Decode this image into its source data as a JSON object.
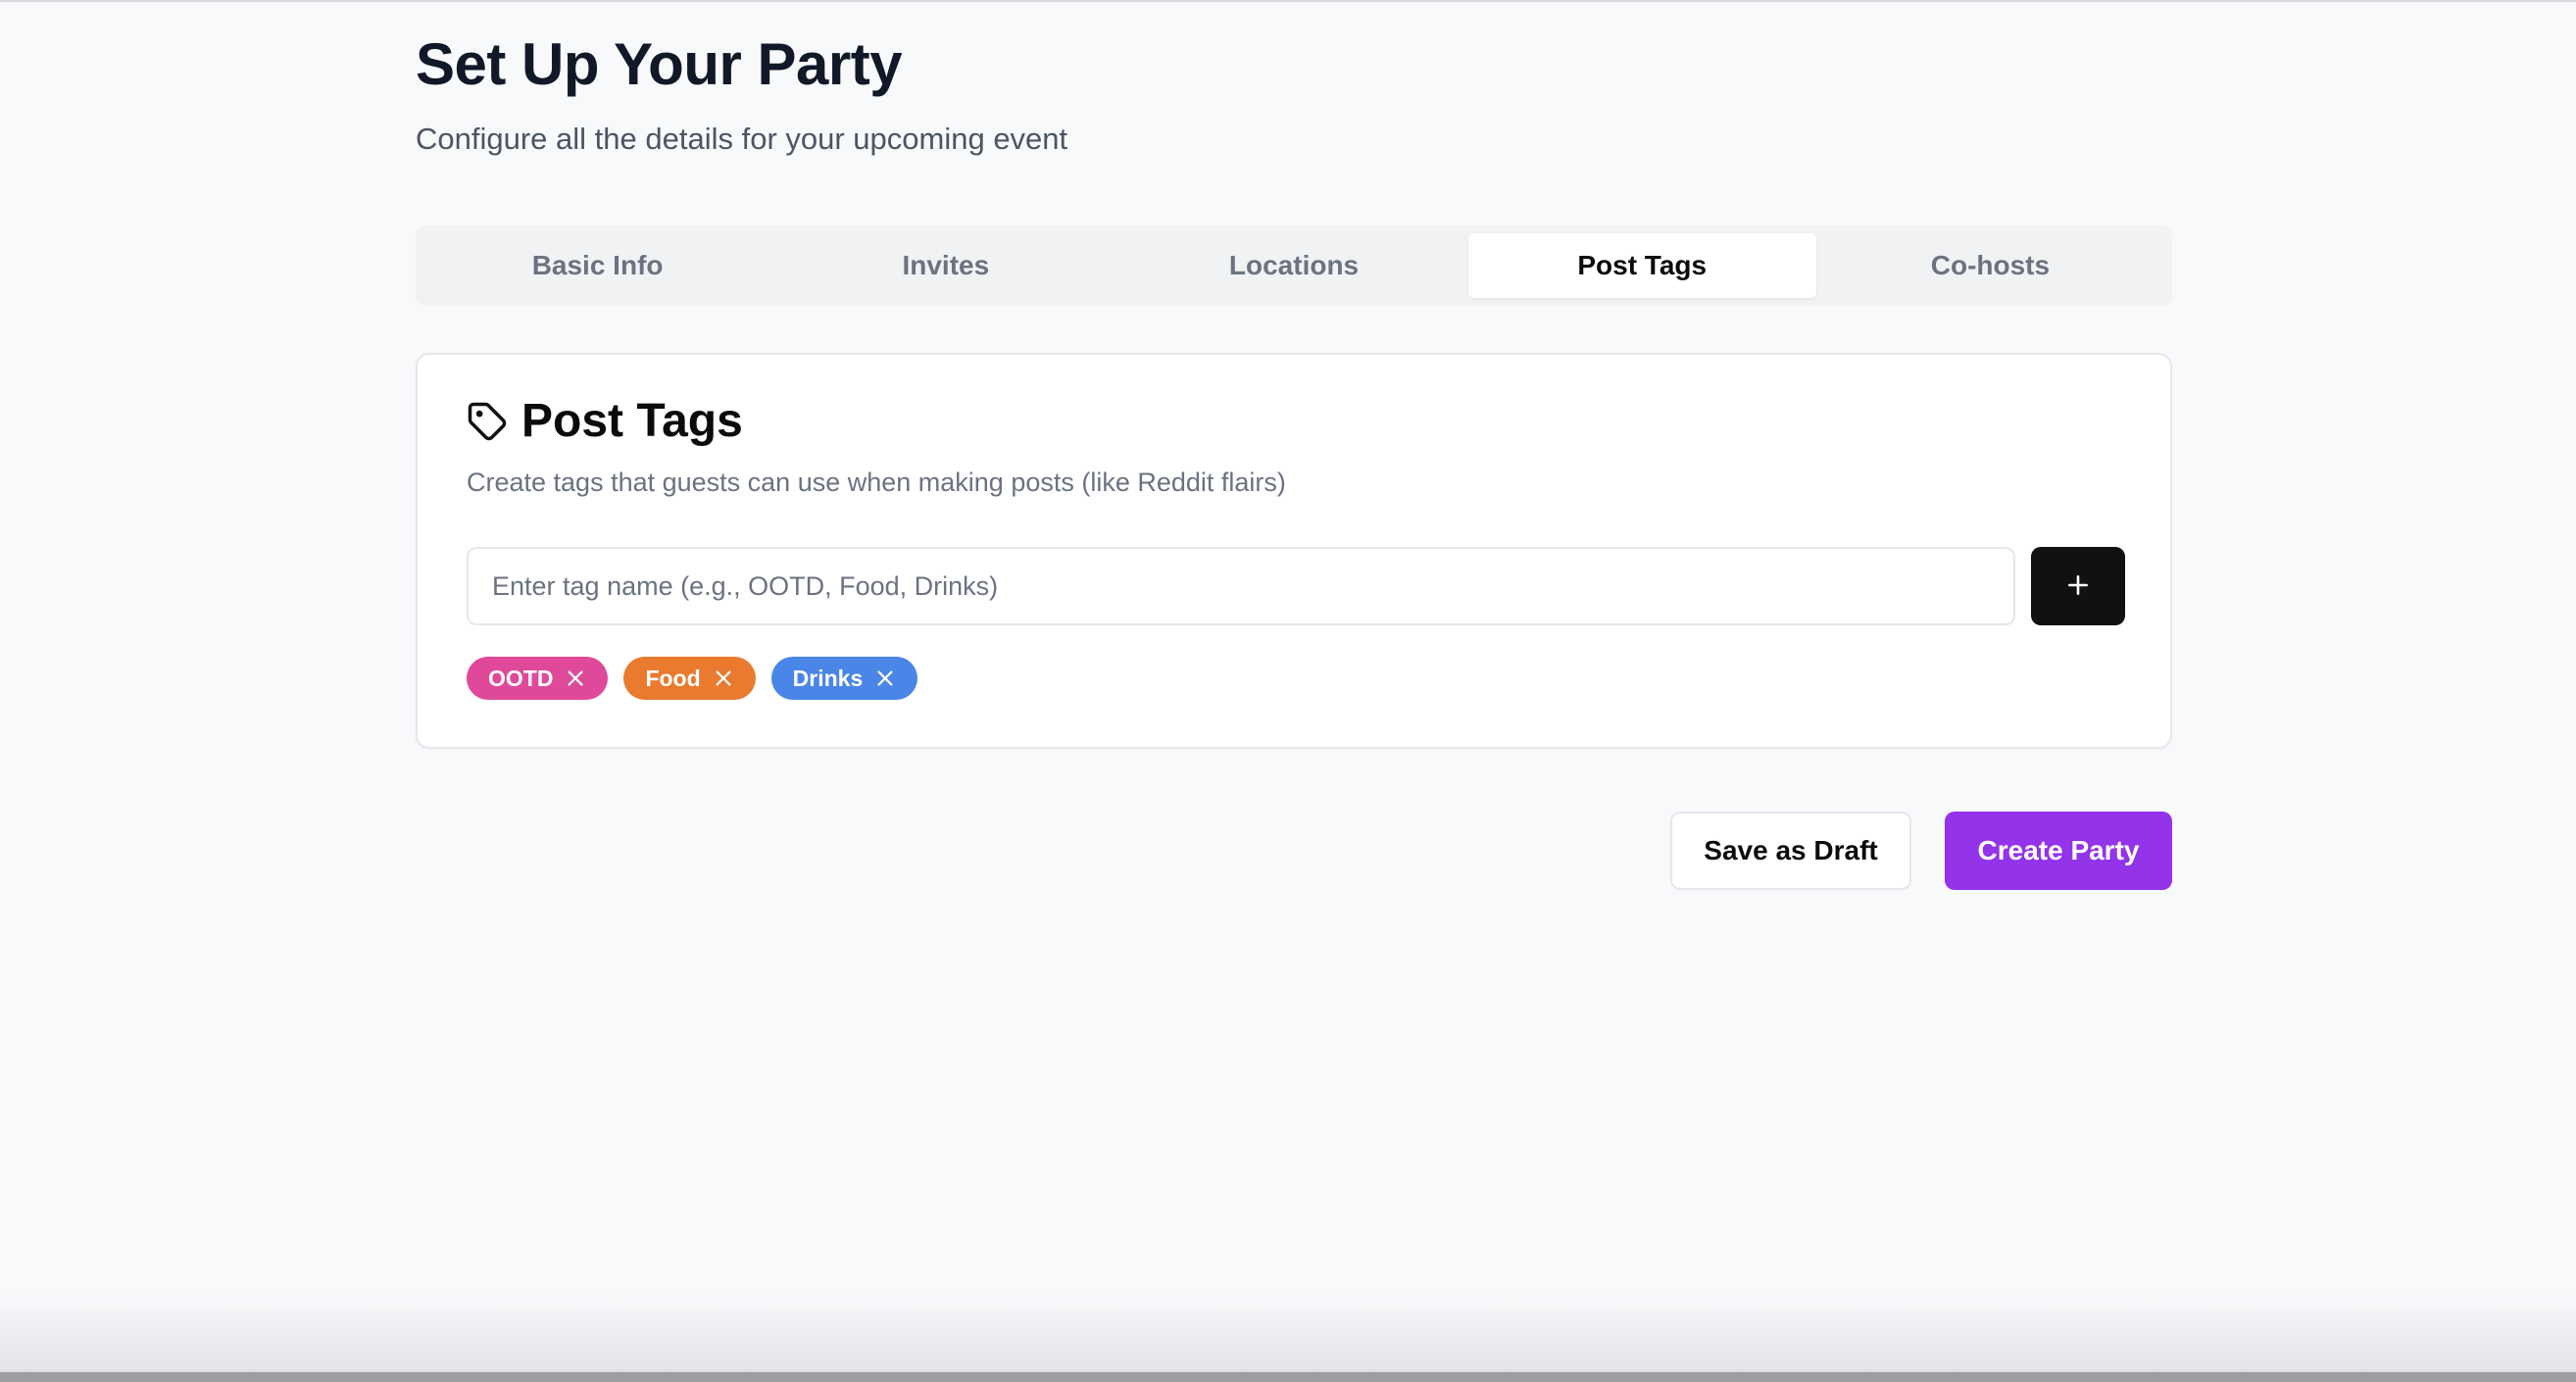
{
  "page": {
    "title": "Set Up Your Party",
    "subtitle": "Configure all the details for your upcoming event"
  },
  "tabs": [
    {
      "label": "Basic Info",
      "active": false
    },
    {
      "label": "Invites",
      "active": false
    },
    {
      "label": "Locations",
      "active": false
    },
    {
      "label": "Post Tags",
      "active": true
    },
    {
      "label": "Co-hosts",
      "active": false
    }
  ],
  "card": {
    "icon": "tag-icon",
    "title": "Post Tags",
    "description": "Create tags that guests can use when making posts (like Reddit flairs)",
    "input": {
      "value": "",
      "placeholder": "Enter tag name (e.g., OOTD, Food, Drinks)"
    },
    "add_button_icon": "plus-icon",
    "tags": [
      {
        "label": "OOTD",
        "color": "#e0499a"
      },
      {
        "label": "Food",
        "color": "#ea7a2e"
      },
      {
        "label": "Drinks",
        "color": "#4a86e8"
      }
    ]
  },
  "actions": {
    "draft_label": "Save as Draft",
    "create_label": "Create Party",
    "create_color": "#9333ea"
  }
}
